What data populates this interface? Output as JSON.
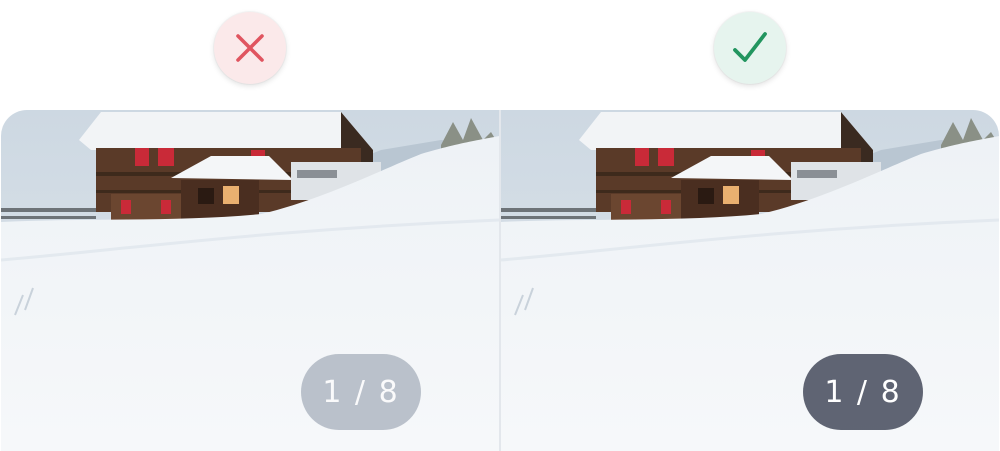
{
  "comparison": {
    "bad_example": {
      "indicator_icon": "cross-icon",
      "indicator_color": "#e05560",
      "indicator_bg": "#fbe9ea",
      "counter_text": "1 / 8",
      "counter_style": "low-contrast"
    },
    "good_example": {
      "indicator_icon": "check-icon",
      "indicator_color": "#22955f",
      "indicator_bg": "#e6f4ee",
      "counter_text": "1 / 8",
      "counter_style": "high-contrast"
    }
  },
  "photo": {
    "subject": "snow-covered-chalet-icon"
  }
}
